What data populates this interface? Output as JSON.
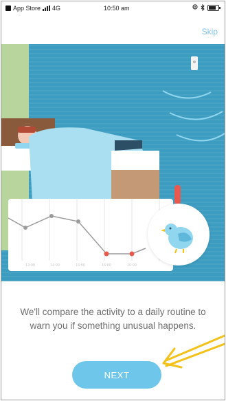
{
  "status_bar": {
    "carrier": "App Store",
    "network": "4G",
    "time": "10:50 am"
  },
  "header": {
    "skip_label": "Skip"
  },
  "illustration": {
    "chart_ticks": [
      "13:00",
      "14:00",
      "15:00",
      "16:00",
      "16:00"
    ]
  },
  "body": {
    "message": "We'll compare the activity to a daily routine to warn you if something unusual happens."
  },
  "footer": {
    "next_label": "NEXT"
  },
  "colors": {
    "accent": "#6ec7ea",
    "wall": "#3d9dc1",
    "alert": "#e85a4f",
    "annotation_arrow": "#f2c21a"
  },
  "icons": [
    "back-badge-icon",
    "signal-icon",
    "location-icon",
    "bluetooth-icon",
    "battery-icon",
    "sensor-icon",
    "bird-icon",
    "exclamation-icon",
    "arrow-annotation-icon"
  ]
}
